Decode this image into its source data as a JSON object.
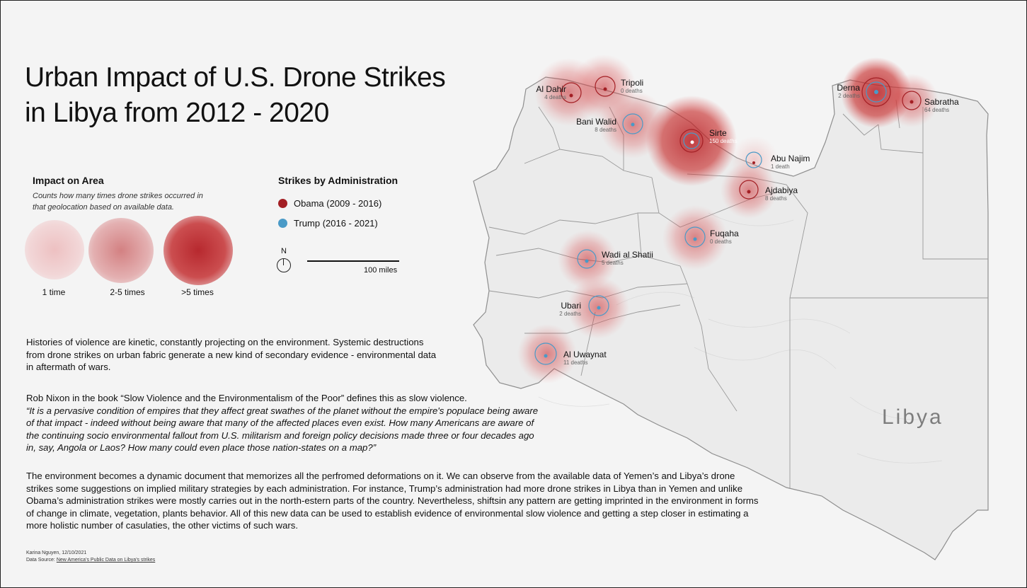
{
  "title": {
    "line1": "Urban Impact of U.S. Drone Strikes",
    "line2": "in Libya from  2012 - 2020"
  },
  "impact_legend": {
    "heading": "Impact on Area",
    "subtitle": "Counts how many times drone strikes occurred in that geolocation based on available data.",
    "items": [
      {
        "label": "1 time"
      },
      {
        "label": "2-5 times"
      },
      {
        "label": ">5 times"
      }
    ]
  },
  "admin_legend": {
    "heading": "Strikes by Administration",
    "items": [
      {
        "label": "Obama (2009 - 2016)",
        "color": "#a31f24"
      },
      {
        "label": "Trump (2016 - 2021)",
        "color": "#4a9ac7"
      }
    ]
  },
  "north_label": "N",
  "scale_label": "100 miles",
  "country_label": "Libya",
  "colors": {
    "obama": "#a31f24",
    "trump": "#4a9ac7",
    "haze": "#d9484a",
    "land": "#ececec",
    "border": "#9a9a9a"
  },
  "cities": [
    {
      "name": "Al Dahir",
      "deaths": "4 deaths",
      "admin": "obama",
      "impact": "2-5 times"
    },
    {
      "name": "Tripoli",
      "deaths": "0 deaths",
      "admin": "obama",
      "impact": "2-5 times"
    },
    {
      "name": "Bani Walid",
      "deaths": "8 deaths",
      "admin": "trump",
      "impact": "2-5 times"
    },
    {
      "name": "Sirte",
      "deaths": "150 deaths",
      "admin": "trump",
      "impact": ">5 times"
    },
    {
      "name": "Abu Najim",
      "deaths": "1 death",
      "admin": "obama",
      "impact": "1 time"
    },
    {
      "name": "Ajdabiya",
      "deaths": "8 deaths",
      "admin": "obama",
      "impact": "2-5 times"
    },
    {
      "name": "Derna",
      "deaths": "2 deaths",
      "admin": "trump",
      "impact": ">5 times"
    },
    {
      "name": "Sabratha",
      "deaths": "64 deaths",
      "admin": "obama",
      "impact": "2-5 times"
    },
    {
      "name": "Fuqaha",
      "deaths": "0 deaths",
      "admin": "trump",
      "impact": "2-5 times"
    },
    {
      "name": "Wadi al Shatii",
      "deaths": "5 deaths",
      "admin": "trump",
      "impact": "2-5 times"
    },
    {
      "name": "Ubari",
      "deaths": "2 deaths",
      "admin": "trump",
      "impact": "2-5 times"
    },
    {
      "name": "Al Uwaynat",
      "deaths": "11 deaths",
      "admin": "trump",
      "impact": "2-5 times"
    }
  ],
  "paragraphs": {
    "p1": "Histories of violence are kinetic, constantly projecting on the environment. Systemic destructions from drone strikes on urban fabric generate a new kind of secondary evidence - environmental data in aftermath of wars.",
    "p2_intro": "Rob Nixon in the book “Slow Violence and the Environmentalism of the Poor” defines this as slow violence.",
    "p2_quote": "“It is a pervasive condition of empires that they affect great swathes of the planet without the empire's populace being aware of that impact - indeed without being aware that many of the affected places even exist. How many Americans are aware of the continuing socio environmental fallout from U.S. militarism and foreign policy decisions made three or four decades ago in, say, Angola or Laos? How many could even place those nation-states on a map?”",
    "p3": "The environment becomes a dynamic document that memorizes all the perfromed deformations on it. We can observe  from the available data of Yemen’s and Libya’s drone strikes some suggestions on implied military strategies by each administration. For instance, Trump’s administration had more drone strikes in Libya than in Yemen and unlike Obama’s administration strikes were mostly carries out in the north-estern parts of the country. Nevertheless, shiftsin any pattern are getting imprinted in the environment in forms of change in climate, vegetation, plants behavior. All of this new data can be used to establish evidence of environmental slow violence and getting a step closer in estimating a more holistic number of casulaties, the other victims of such wars."
  },
  "credit": {
    "author": "Karina Nguyen, 12/10/2021",
    "source_prefix": "Data Source: ",
    "source_link": "New America’s Public Data on Libya’s strikes"
  }
}
